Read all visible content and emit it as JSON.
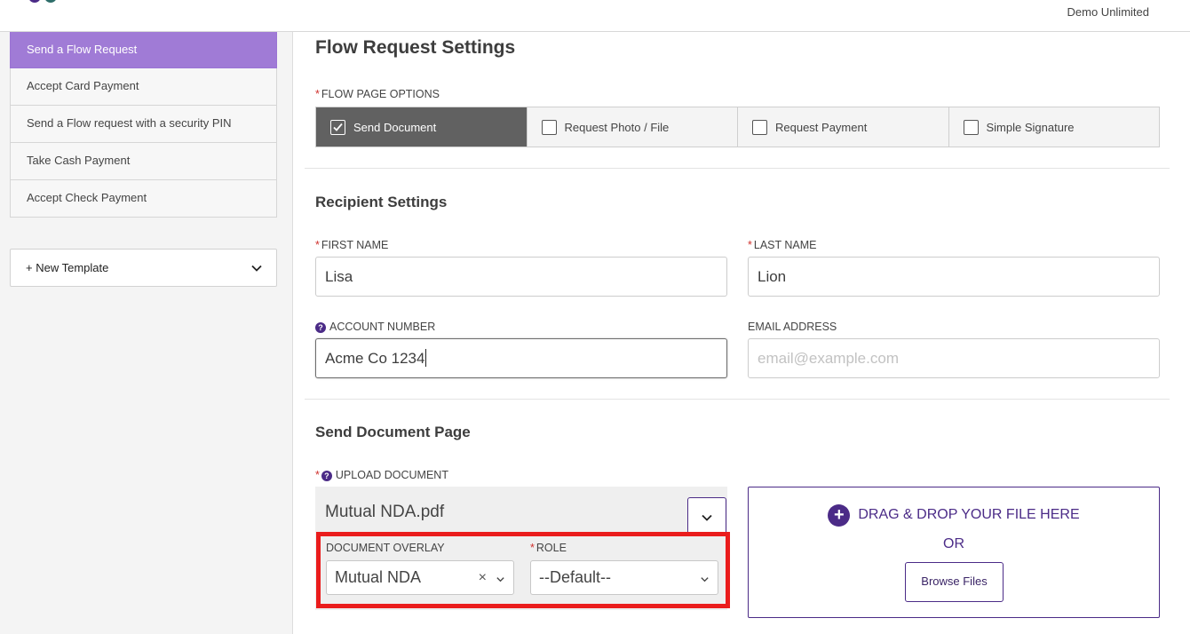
{
  "header": {
    "org_name": "Demo Unlimited"
  },
  "sidebar": {
    "items": [
      {
        "label": "Send a Flow Request",
        "active": true
      },
      {
        "label": "Accept Card Payment"
      },
      {
        "label": "Send a Flow request with a security PIN"
      },
      {
        "label": "Take Cash Payment"
      },
      {
        "label": "Accept Check Payment"
      }
    ],
    "new_template": {
      "plus": "+",
      "label": "New Template"
    }
  },
  "main": {
    "title": "Flow Request Settings",
    "flow_page_options": {
      "label": "FLOW PAGE OPTIONS",
      "options": [
        {
          "label": "Send Document",
          "checked": true
        },
        {
          "label": "Request Photo / File",
          "checked": false
        },
        {
          "label": "Request Payment",
          "checked": false
        },
        {
          "label": "Simple Signature",
          "checked": false
        }
      ]
    },
    "recipient": {
      "title": "Recipient Settings",
      "first_name": {
        "label": "FIRST NAME",
        "value": "Lisa"
      },
      "last_name": {
        "label": "LAST NAME",
        "value": "Lion"
      },
      "account_number": {
        "label": "ACCOUNT NUMBER",
        "value": "Acme Co 1234"
      },
      "email": {
        "label": "EMAIL ADDRESS",
        "value": "",
        "placeholder": "email@example.com"
      }
    },
    "document_page": {
      "title": "Send Document Page",
      "upload": {
        "label": "UPLOAD DOCUMENT",
        "value": "Mutual NDA.pdf"
      },
      "overlay": {
        "label": "DOCUMENT OVERLAY",
        "value": "Mutual NDA",
        "clear": "×"
      },
      "role": {
        "label": "ROLE",
        "value": "--Default--"
      },
      "dropzone": {
        "text": "DRAG & DROP YOUR FILE HERE",
        "or": "OR",
        "browse": "Browse Files",
        "plus": "+"
      }
    }
  },
  "colors": {
    "accent": "#4b2b87",
    "active_nav": "#a07bd6",
    "highlight": "#ea1c1c",
    "required": "#d0312d"
  },
  "required_marker": "*",
  "help_glyph": "?"
}
